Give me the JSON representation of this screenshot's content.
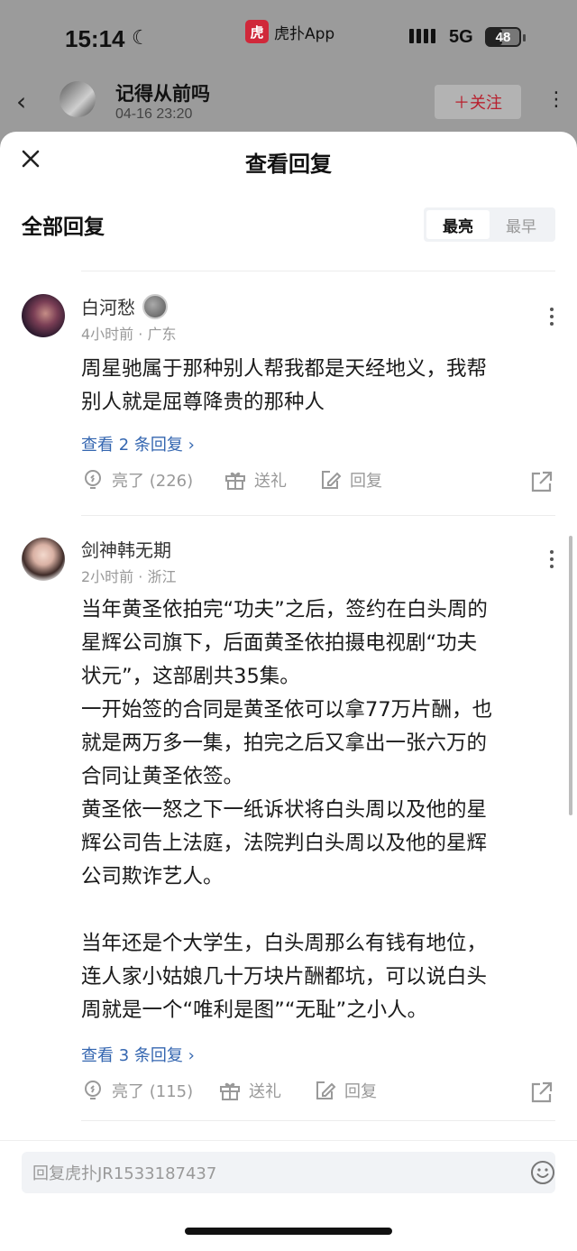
{
  "status": {
    "time": "15:14",
    "app_name": "虎扑App",
    "app_logo_text": "虎",
    "network": "5G",
    "battery": "48",
    "battery_level_pct": 48
  },
  "background_post": {
    "author": "记得从前吗",
    "date": "04-16 23:20",
    "follow_label": "＋关注"
  },
  "sheet": {
    "title": "查看回复",
    "section_title": "全部回复",
    "sort_options": [
      "最亮",
      "最早"
    ],
    "sort_selected": "最亮"
  },
  "comments": [
    {
      "username": "白河愁",
      "meta": "4小时前 · 广东",
      "content": "周星驰属于那种别人帮我都是天经地义，我帮\n别人就是屈尊降贵的那种人",
      "view_replies": "查看 2 条回复 ›",
      "light_label": "亮了 (226)",
      "gift_label": "送礼",
      "reply_label": "回复"
    },
    {
      "username": "剑神韩无期",
      "meta": "2小时前 · 浙江",
      "content": "当年黄圣依拍完“功夫”之后，签约在白头周的\n星辉公司旗下，后面黄圣依拍摄电视剧“功夫\n状元”，这部剧共35集。\n一开始签的合同是黄圣依可以拿77万片酬，也\n就是两万多一集，拍完之后又拿出一张六万的\n合同让黄圣依签。\n黄圣依一怒之下一纸诉状将白头周以及他的星\n辉公司告上法庭，法院判白头周以及他的星辉\n公司欺诈艺人。\n\n当年还是个大学生，白头周那么有钱有地位，\n连人家小姑娘几十万块片酬都坑，可以说白头\n周就是一个“唯利是图”“无耻”之小人。",
      "view_replies": "查看 3 条回复 ›",
      "light_label": "亮了 (115)",
      "gift_label": "送礼",
      "reply_label": "回复"
    }
  ],
  "reply_bar": {
    "placeholder": "回复虎扑JR1533187437"
  },
  "colors": {
    "link": "#3466b0",
    "brand": "#d0283a",
    "muted": "#999999"
  }
}
